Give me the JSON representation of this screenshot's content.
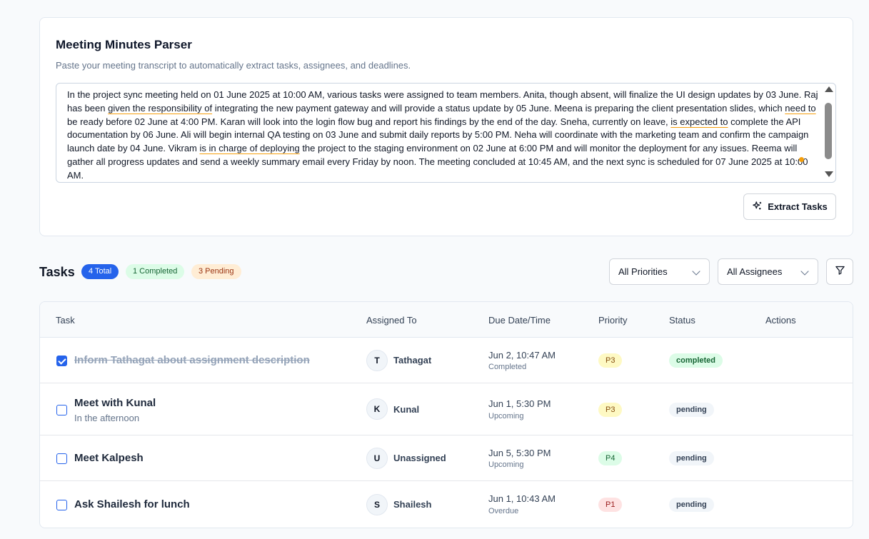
{
  "parser": {
    "title": "Meeting Minutes Parser",
    "subtitle": "Paste your meeting transcript to automatically extract tasks, assignees, and deadlines.",
    "transcript_segments": [
      "In the project sync meeting held on 01 June 2025 at 10:00 AM, various tasks were assigned to team members. Anita, though absent, will finalize the UI design updates by 03 June. Raj has been ",
      "given the responsibility of",
      " integrating the new payment gateway and will provide a status update by 05 June. Meena is preparing the client presentation slides, which ",
      "need to",
      " be ready before 02 June at 4:00 PM. Karan will look into the login flow bug and report his findings by the end of the day. Sneha, currently on leave, ",
      "is expected to",
      " complete the API documentation by 06 June. Ali will begin internal QA testing on 03 June and submit daily reports by 5:00 PM. Neha will coordinate with the marketing team and confirm the campaign launch date by 04 June. Vikram ",
      "is in charge of deploying",
      " the project to the staging environment on 02 June at 6:00 PM and will monitor the deployment for any issues. Reema will gather all progress updates and send a weekly summary email every Friday by noon. The meeting concluded at 10:45 AM, and the next sync is scheduled for 07 June 2025 at 10:00 AM."
    ],
    "extract_label": "Extract Tasks"
  },
  "tasks_header": {
    "title": "Tasks",
    "total_badge": "4 Total",
    "completed_badge": "1 Completed",
    "pending_badge": "3 Pending",
    "priority_filter": "All Priorities",
    "assignee_filter": "All Assignees"
  },
  "table": {
    "columns": [
      "Task",
      "Assigned To",
      "Due Date/Time",
      "Priority",
      "Status",
      "Actions"
    ],
    "rows": [
      {
        "title": "Inform Tathagat about assignment description",
        "description": "",
        "checked": true,
        "initial": "T",
        "assignee": "Tathagat",
        "due": "Jun 2, 10:47 AM",
        "due_status": "Completed",
        "priority": "P3",
        "status": "completed"
      },
      {
        "title": "Meet with Kunal",
        "description": "In the afternoon",
        "checked": false,
        "initial": "K",
        "assignee": "Kunal",
        "due": "Jun 1, 5:30 PM",
        "due_status": "Upcoming",
        "priority": "P3",
        "status": "pending"
      },
      {
        "title": "Meet Kalpesh",
        "description": "",
        "checked": false,
        "initial": "U",
        "assignee": "Unassigned",
        "due": "Jun 5, 5:30 PM",
        "due_status": "Upcoming",
        "priority": "P4",
        "status": "pending"
      },
      {
        "title": "Ask Shailesh for lunch",
        "description": "",
        "checked": false,
        "initial": "S",
        "assignee": "Shailesh",
        "due": "Jun 1, 10:43 AM",
        "due_status": "Overdue",
        "priority": "P1",
        "status": "pending"
      }
    ]
  },
  "colors": {
    "accent": "#2563eb",
    "grammar_underline": "#f59e0b"
  }
}
